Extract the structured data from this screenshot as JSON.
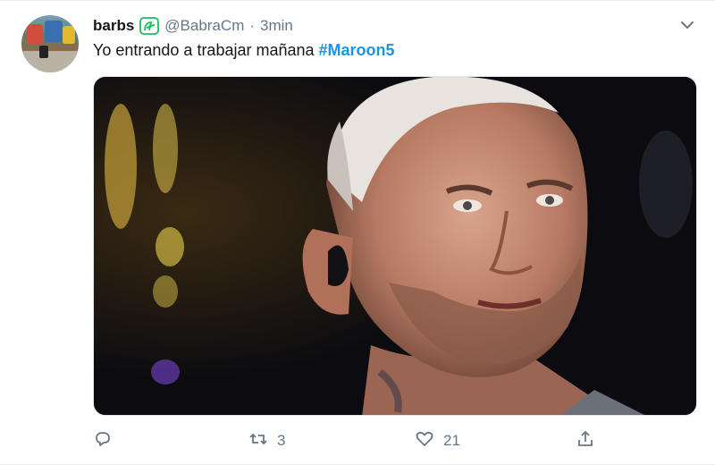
{
  "tweet": {
    "author_name": "barbs",
    "handle": "@BabraCm",
    "separator": "·",
    "time": "3min",
    "text_plain": "Yo entrando a trabajar mañana ",
    "hashtag": "#Maroon5",
    "icons": {
      "badge": "sprout-icon",
      "menu": "chevron-down-icon",
      "reply": "reply-icon",
      "retweet": "retweet-icon",
      "like": "heart-icon",
      "share": "share-icon"
    },
    "stats": {
      "retweets": "3",
      "likes": "21"
    },
    "colors": {
      "link": "#1b95e0",
      "muted": "#657786",
      "badge": "#17bf63"
    }
  }
}
